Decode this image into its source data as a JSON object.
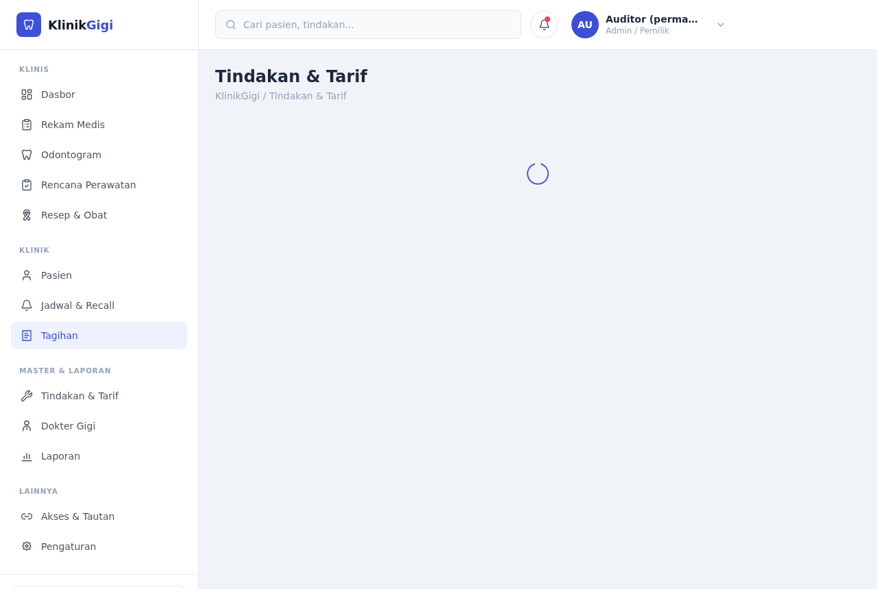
{
  "brand": {
    "name": "Klinik",
    "accent": "Gigi"
  },
  "sidebar": {
    "sections": [
      {
        "label": "KLINIS",
        "items": [
          {
            "label": "Dasbor",
            "selected": false
          },
          {
            "label": "Rekam Medis",
            "selected": false
          },
          {
            "label": "Odontogram",
            "selected": false
          },
          {
            "label": "Rencana Perawatan",
            "selected": false
          },
          {
            "label": "Resep & Obat",
            "selected": false
          }
        ]
      },
      {
        "label": "KLINIK",
        "items": [
          {
            "label": "Pasien",
            "selected": false
          },
          {
            "label": "Jadwal & Recall",
            "selected": false
          },
          {
            "label": "Tagihan",
            "selected": true
          }
        ]
      },
      {
        "label": "MASTER & LAPORAN",
        "items": [
          {
            "label": "Tindakan & Tarif",
            "selected": false
          },
          {
            "label": "Dokter Gigi",
            "selected": false
          },
          {
            "label": "Laporan",
            "selected": false
          }
        ]
      },
      {
        "label": "LAINNYA",
        "items": [
          {
            "label": "Akses & Tautan",
            "selected": false
          },
          {
            "label": "Pengaturan",
            "selected": false
          }
        ]
      }
    ]
  },
  "header": {
    "search": {
      "placeholder": "Cari pasien, tindakan..."
    },
    "notifications": {
      "unread": true
    },
    "user": {
      "initials": "AU",
      "name": "Auditor (perma…",
      "role": "Admin / Pemilik"
    }
  },
  "page": {
    "title": "Tindakan & Tarif",
    "breadcrumb": "KlinikGigi / Tindakan & Tarif",
    "loading": true
  }
}
